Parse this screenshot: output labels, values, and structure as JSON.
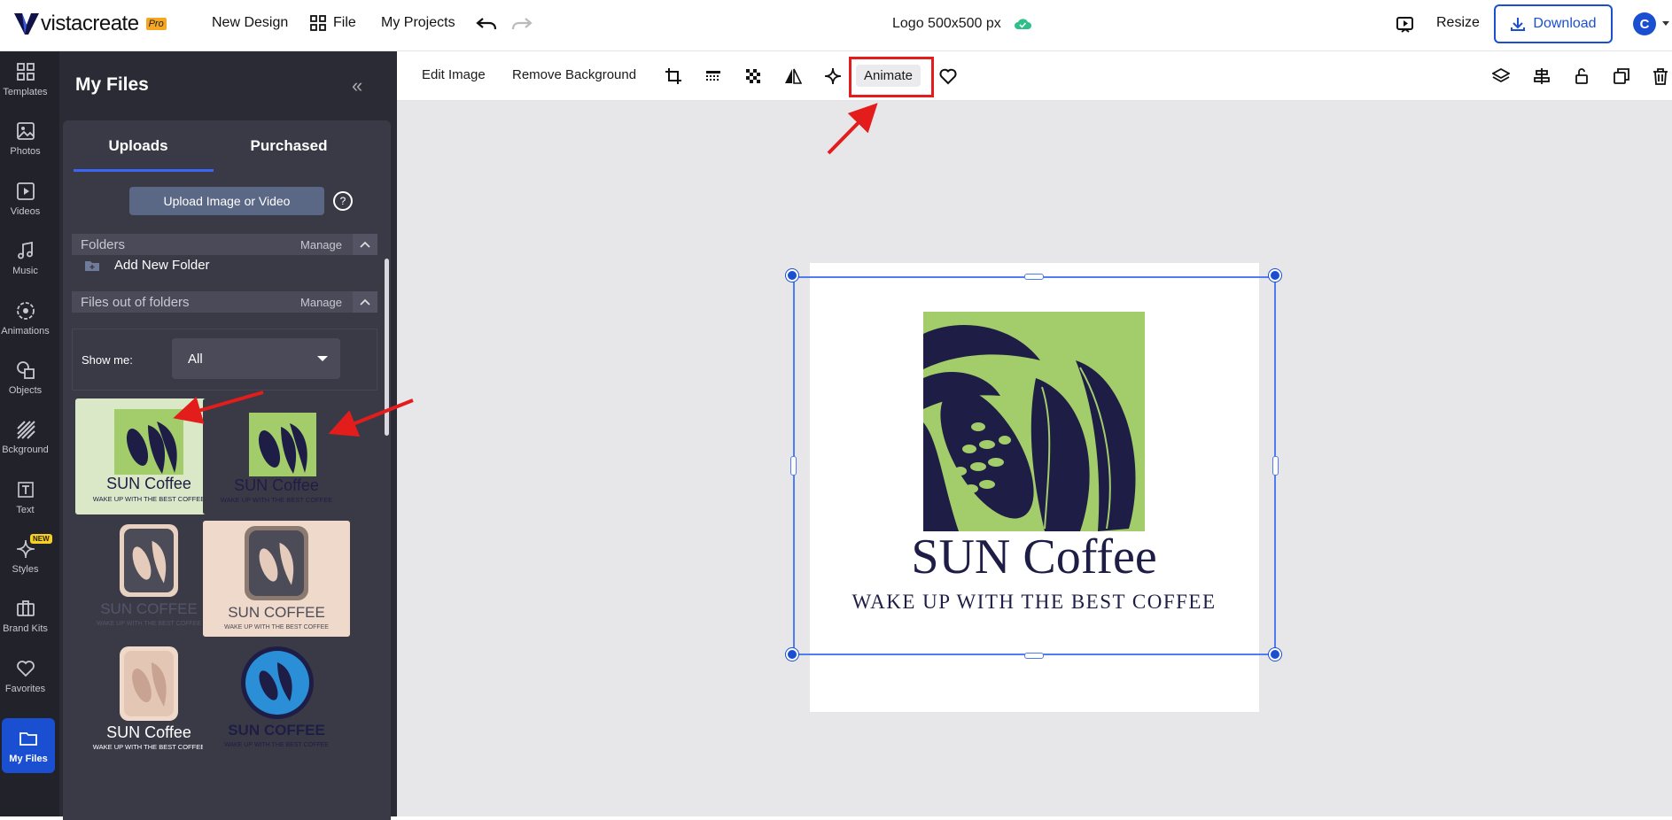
{
  "brand": {
    "name": "vistacreate",
    "badge": "Pro"
  },
  "topnav": {
    "new_design": "New Design",
    "file": "File",
    "my_projects": "My Projects"
  },
  "document": {
    "title": "Logo 500x500 px"
  },
  "topright": {
    "resize": "Resize",
    "download": "Download",
    "avatar": "C"
  },
  "rail": [
    {
      "label": "Templates",
      "icon": "grid-icon"
    },
    {
      "label": "Photos",
      "icon": "image-icon"
    },
    {
      "label": "Videos",
      "icon": "play-icon"
    },
    {
      "label": "Music",
      "icon": "music-icon"
    },
    {
      "label": "Animations",
      "icon": "animation-icon"
    },
    {
      "label": "Objects",
      "icon": "shapes-icon"
    },
    {
      "label": "Bckground",
      "icon": "background-icon"
    },
    {
      "label": "Text",
      "icon": "text-icon"
    },
    {
      "label": "Styles",
      "icon": "sparkle-icon",
      "badge": "NEW"
    },
    {
      "label": "Brand Kits",
      "icon": "briefcase-icon"
    },
    {
      "label": "Favorites",
      "icon": "heart-icon"
    },
    {
      "label": "My Files",
      "icon": "folder-icon",
      "active": true
    }
  ],
  "panel": {
    "title": "My Files",
    "tabs": [
      "Uploads",
      "Purchased"
    ],
    "upload_button": "Upload Image or Video",
    "help": "?",
    "folders_label": "Folders",
    "manage": "Manage",
    "add_new_folder": "Add New Folder",
    "files_out_label": "Files out of folders",
    "show_me_label": "Show me:",
    "show_me_value": "All"
  },
  "thumbnails": [
    {
      "title": "SUN Coffee",
      "tagline": "WAKE UP WITH THE BEST COFFEE",
      "style": "green-light"
    },
    {
      "title": "SUN Coffee",
      "tagline": "WAKE UP WITH THE BEST COFFEE",
      "style": "green-dark"
    },
    {
      "title": "SUN COFFEE",
      "tagline": "WAKE UP WITH THE BEST COFFEE",
      "style": "beige-dark"
    },
    {
      "title": "SUN COFFEE",
      "tagline": "WAKE UP WITH THE BEST COFFEE",
      "style": "beige-light"
    },
    {
      "title": "SUN Coffee",
      "tagline": "WAKE UP WITH THE BEST COFFEE",
      "style": "pink-dark"
    },
    {
      "title": "SUN COFFEE",
      "tagline": "WAKE UP WITH THE BEST COFFEE",
      "style": "blue-dark"
    }
  ],
  "toolbar": {
    "edit_image": "Edit Image",
    "remove_background": "Remove Background",
    "animate": "Animate"
  },
  "canvas": {
    "logo_title": "SUN Coffee",
    "logo_tagline": "WAKE UP WITH THE BEST COFFEE"
  },
  "colors": {
    "accent": "#1b4fd1",
    "logo_green": "#a3cc6b",
    "logo_navy": "#1e1d45",
    "annotation_red": "#e31c1c"
  }
}
